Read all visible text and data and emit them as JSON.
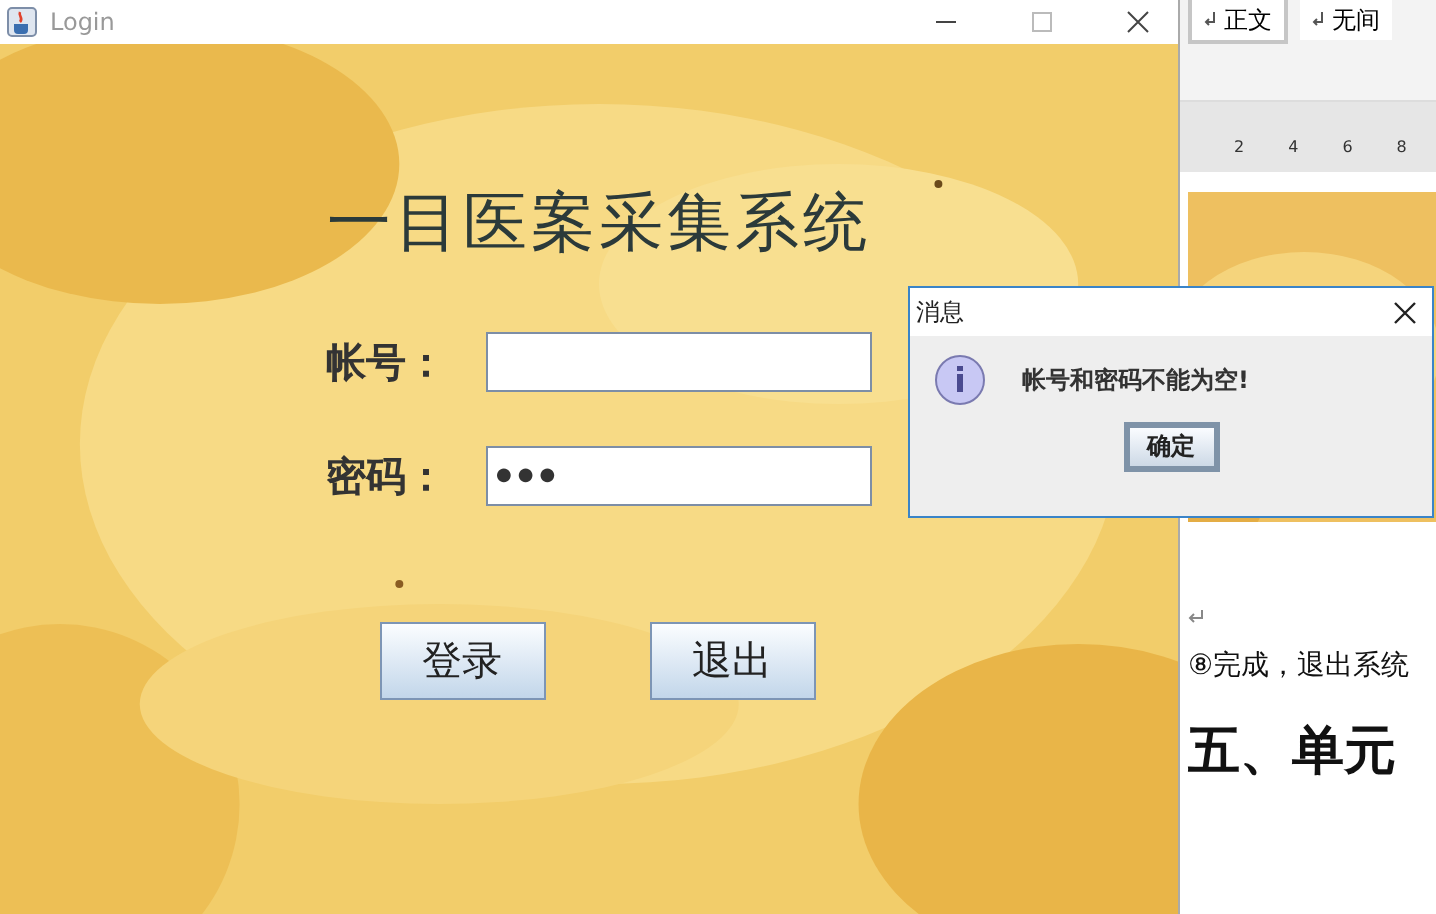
{
  "window": {
    "title": "Login"
  },
  "login": {
    "heading": "一目医案采集系统",
    "fields": [
      {
        "label": "帐号："
      },
      {
        "label": "密码：",
        "value": "●●●"
      }
    ],
    "buttons": [
      "登录",
      "退出"
    ]
  },
  "dialog": {
    "title": "消息",
    "message": "帐号和密码不能为空!",
    "button": "确定"
  },
  "document": {
    "styles": [
      {
        "label": "正文",
        "selected": true
      },
      {
        "label": "无间",
        "selected": false
      }
    ],
    "ruler": [
      "2",
      "4",
      "6",
      "8"
    ],
    "lines": [
      {
        "kind": "text",
        "text": "⑧完成，退出系统"
      },
      {
        "kind": "heading",
        "text": "五、单元"
      }
    ]
  }
}
